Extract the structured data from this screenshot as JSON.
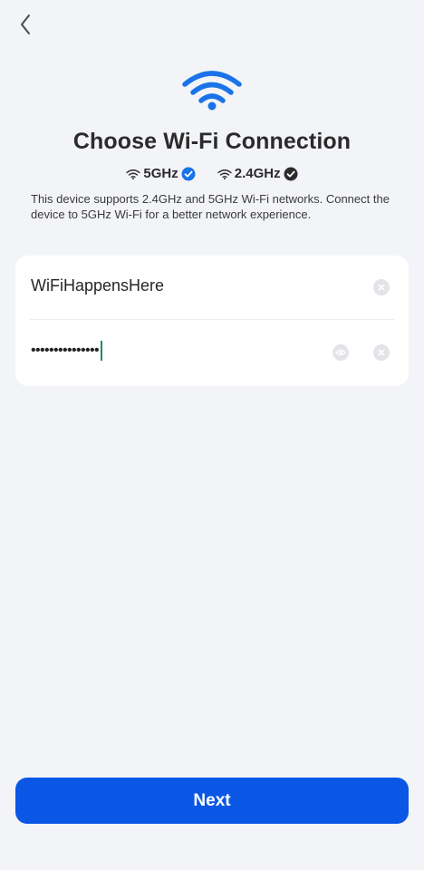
{
  "header": {
    "back_icon": "chevron-left-icon"
  },
  "hero": {
    "icon": "wifi-icon",
    "color": "#1a73e8"
  },
  "title": "Choose Wi-Fi Connection",
  "bands": [
    {
      "label": "5GHz",
      "icon": "wifi-small-icon",
      "check_icon": "check-circle-icon",
      "check_color": "#1a73e8"
    },
    {
      "label": "2.4GHz",
      "icon": "wifi-small-icon",
      "check_icon": "check-circle-icon",
      "check_color": "#2b2b2b"
    }
  ],
  "description": "This device supports 2.4GHz and 5GHz Wi-Fi networks. Connect the device to 5GHz Wi-Fi for a better network experience.",
  "form": {
    "ssid_value": "WiFiHappensHere",
    "password_masked": "•••••••••••••••",
    "clear_icon": "clear-icon",
    "eye_icon": "eye-icon"
  },
  "next_label": "Next",
  "colors": {
    "primary": "#0a57e6",
    "background": "#f3f4f7"
  }
}
